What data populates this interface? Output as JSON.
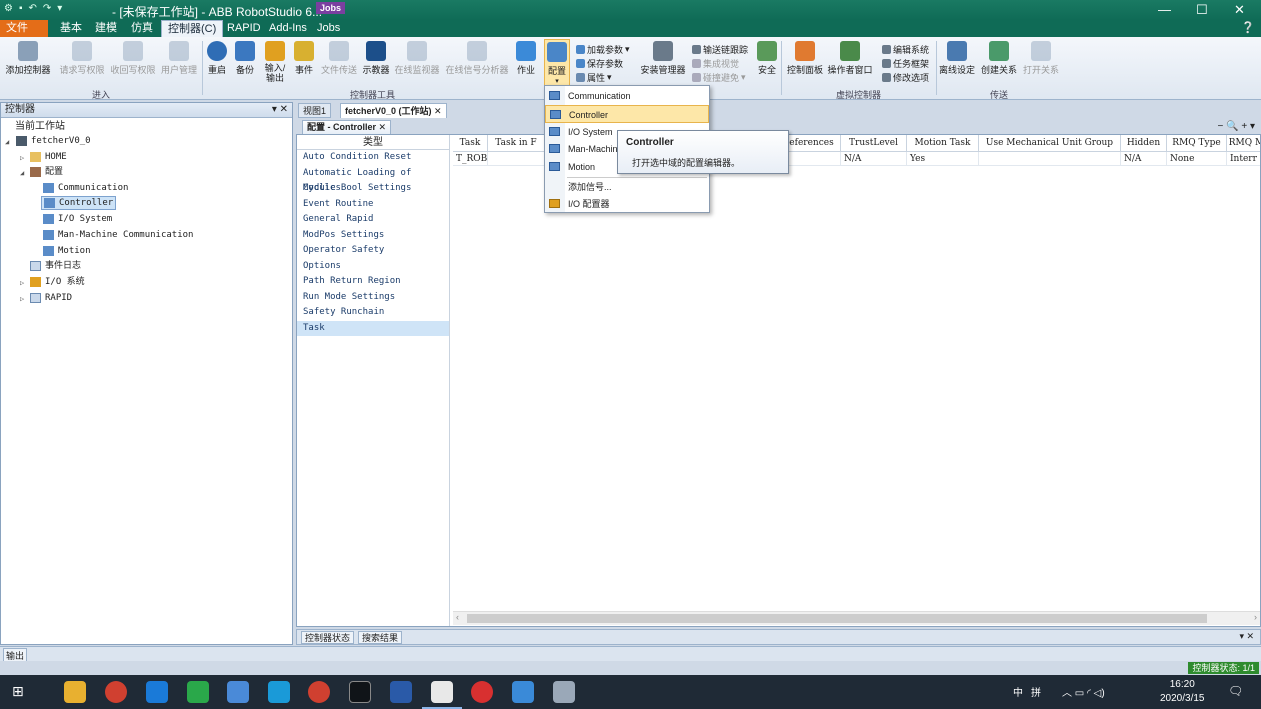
{
  "window": {
    "title": "- [未保存工作站] - ABB RobotStudio 6...",
    "jobs_badge": "Jobs",
    "minimize": "—",
    "maximize": "☐",
    "close": "✕"
  },
  "ribbon_tabs": [
    {
      "label": "文件 (F)"
    },
    {
      "label": "基本"
    },
    {
      "label": "建模"
    },
    {
      "label": "仿真"
    },
    {
      "label": "控制器(C)"
    },
    {
      "label": "RAPID"
    },
    {
      "label": "Add-Ins"
    },
    {
      "label": "Jobs"
    }
  ],
  "ribbon": {
    "buttons": [
      {
        "label": "添加控制器"
      },
      {
        "label": "请求写权限"
      },
      {
        "label": "收回写权限"
      },
      {
        "label": "用户管理"
      },
      {
        "label": "重启"
      },
      {
        "label": "备份"
      },
      {
        "label": "输入/\n输出"
      },
      {
        "label": "事件"
      },
      {
        "label": "文件传送"
      },
      {
        "label": "示教器"
      },
      {
        "label": "在线监视器"
      },
      {
        "label": "在线信号分析器"
      },
      {
        "label": "作业"
      },
      {
        "label": "配置"
      },
      {
        "label": "安装管理器"
      },
      {
        "label": "安全"
      },
      {
        "label": "控制面板"
      },
      {
        "label": "操作者窗口"
      },
      {
        "label": "离线设定"
      },
      {
        "label": "创建关系"
      },
      {
        "label": "打开关系"
      }
    ],
    "small": [
      {
        "label": "加载参数"
      },
      {
        "label": "保存参数"
      },
      {
        "label": "属性"
      },
      {
        "label": "输送链跟踪"
      },
      {
        "label": "集成视觉"
      },
      {
        "label": "碰撞避免"
      },
      {
        "label": "编辑系统"
      },
      {
        "label": "任务框架"
      },
      {
        "label": "修改选项"
      }
    ],
    "groups": [
      {
        "label": "进入"
      },
      {
        "label": "控制器工具"
      },
      {
        "label": "虚拟控制器"
      },
      {
        "label": "传送"
      }
    ]
  },
  "left_panel": {
    "title": "控制器",
    "ctrl": "▾ ✕",
    "tree": [
      {
        "label": "当前工作站"
      },
      {
        "label": "fetcherV0_0"
      },
      {
        "label": "HOME"
      },
      {
        "label": "配置"
      },
      {
        "label": "Communication"
      },
      {
        "label": "Controller"
      },
      {
        "label": "I/O System"
      },
      {
        "label": "Man-Machine Communication"
      },
      {
        "label": "Motion"
      },
      {
        "label": "事件日志"
      },
      {
        "label": "I/O 系统"
      },
      {
        "label": "RAPID"
      }
    ]
  },
  "doc_tabs": [
    {
      "label": "视图1"
    },
    {
      "label": "fetcherV0_0 (工作站)"
    }
  ],
  "config_tab": {
    "label": "配置 - Controller"
  },
  "main_ctrls": "− 🔍 + ▾",
  "type_list": {
    "header": "类型",
    "items": [
      "Auto Condition Reset",
      "Automatic Loading of Modules",
      "Cyclic Bool Settings",
      "Event Routine",
      "General Rapid",
      "ModPos Settings",
      "Operator Safety",
      "Options",
      "Path Return Region",
      "Run Mode Settings",
      "Safety Runchain",
      "Task"
    ],
    "selected_index": 11
  },
  "grid": {
    "columns": [
      "Task",
      "Task in F",
      "eferences",
      "TrustLevel",
      "Motion Task",
      "Use Mechanical Unit Group",
      "Hidden",
      "RMQ Type",
      "RMQ M"
    ],
    "row": [
      "T_ROB1",
      "",
      "",
      "N/A",
      "Yes",
      "",
      "N/A",
      "None",
      "Interr"
    ]
  },
  "dropdown": {
    "items": [
      {
        "label": "Communication"
      },
      {
        "label": "Controller"
      },
      {
        "label": "I/O System"
      },
      {
        "label": "Man-Machin"
      },
      {
        "label": "Motion"
      },
      {
        "label": "添加信号..."
      },
      {
        "label": "I/O 配置器"
      }
    ],
    "hovered": "Controller"
  },
  "tooltip": {
    "title": "Controller",
    "body": "打开选中域的配置编辑器。"
  },
  "bottom_tabs": [
    {
      "label": "控制器状态"
    },
    {
      "label": "搜索结果"
    }
  ],
  "output": {
    "label": "输出"
  },
  "status": {
    "text": "控制器状态: 1/1"
  },
  "taskbar": {
    "tray_lang": "中",
    "tray_ime": "拼",
    "tray_icons": "︿ ▭ ◜ ◁)",
    "time": "16:20",
    "date": "2020/3/15"
  },
  "colors": {
    "title_bar": "#0f6b56",
    "file_tab": "#e46d18",
    "highlight": "#fde7a8",
    "status_green": "#2e8b2e"
  }
}
